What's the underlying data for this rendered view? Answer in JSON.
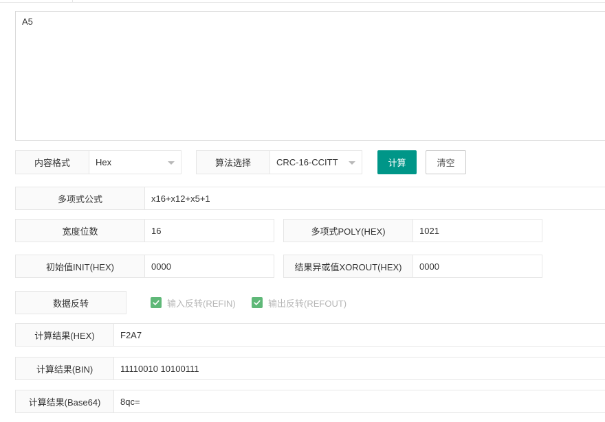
{
  "input": {
    "value": "A5"
  },
  "format": {
    "label": "内容格式",
    "selected": "Hex"
  },
  "algorithm": {
    "label": "算法选择",
    "selected": "CRC-16-CCITT"
  },
  "actions": {
    "calculate": "计算",
    "clear": "清空"
  },
  "polynomial": {
    "label": "多项式公式",
    "value": "x16+x12+x5+1"
  },
  "width": {
    "label": "宽度位数",
    "value": "16"
  },
  "poly_hex": {
    "label": "多项式POLY(HEX)",
    "value": "1021"
  },
  "init": {
    "label": "初始值INIT(HEX)",
    "value": "0000"
  },
  "xorout": {
    "label": "结果异或值XOROUT(HEX)",
    "value": "0000"
  },
  "reflect": {
    "label": "数据反转",
    "refin": {
      "label": "输入反转(REFIN)",
      "checked": true
    },
    "refout": {
      "label": "输出反转(REFOUT)",
      "checked": true
    }
  },
  "results": {
    "hex": {
      "label": "计算结果(HEX)",
      "value": "F2A7"
    },
    "bin": {
      "label": "计算结果(BIN)",
      "value": "11110010 10100111"
    },
    "base64": {
      "label": "计算结果(Base64)",
      "value": "8qc="
    }
  },
  "colors": {
    "primary": "#009688",
    "checkbox": "#5fb878",
    "label_bg": "#fafafa",
    "border": "#e6e6e6"
  }
}
